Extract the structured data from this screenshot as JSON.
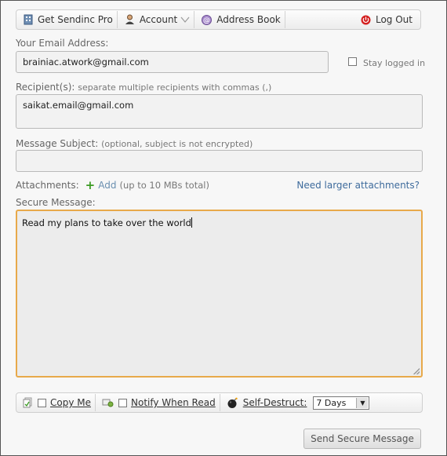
{
  "toolbar": {
    "get_pro": "Get Sendinc Pro",
    "account": "Account",
    "address_book": "Address Book",
    "logout": "Log Out"
  },
  "email": {
    "label": "Your Email Address:",
    "value": "brainiac.atwork@gmail.com",
    "stay_logged_in": "Stay logged in",
    "stay_logged_in_checked": false
  },
  "recipients": {
    "label": "Recipient(s):",
    "hint": "separate multiple recipients with commas (,)",
    "value": "saikat.email@gmail.com"
  },
  "subject": {
    "label": "Message Subject:",
    "hint": "(optional, subject is not encrypted)",
    "value": ""
  },
  "attachments": {
    "label": "Attachments:",
    "add": "Add",
    "limit": "(up to 10 MBs total)",
    "larger_link": "Need larger attachments?"
  },
  "message": {
    "label": "Secure Message:",
    "value": "Read my plans to take over the world"
  },
  "options": {
    "copy_me": "Copy Me",
    "copy_me_checked": false,
    "notify": "Notify When Read",
    "notify_checked": false,
    "self_destruct": "Self-Destruct:",
    "self_destruct_value": "7 Days"
  },
  "send_button": "Send Secure Message",
  "colors": {
    "focus_border": "#e8a94a",
    "link": "#3e6b9c",
    "add_plus": "#3a9a22"
  }
}
